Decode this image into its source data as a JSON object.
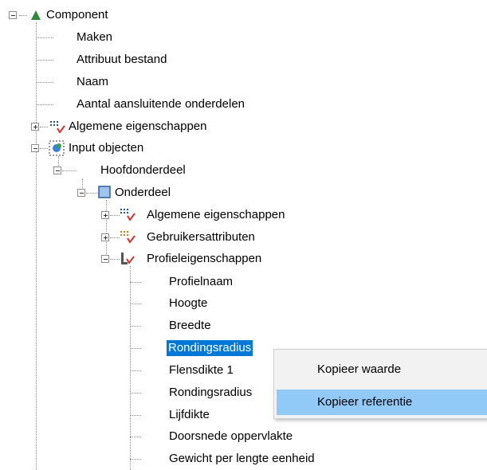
{
  "tree": {
    "component": "Component",
    "maken": "Maken",
    "attribuut_bestand": "Attribuut bestand",
    "naam": "Naam",
    "aantal": "Aantal aansluitende onderdelen",
    "algemene1": "Algemene eigenschappen",
    "input_objecten": "Input objecten",
    "hoofdonderdeel": "Hoofdonderdeel",
    "onderdeel": "Onderdeel",
    "algemene2": "Algemene eigenschappen",
    "gebruikersattributen": "Gebruikersattributen",
    "profieleigenschappen": "Profieleigenschappen",
    "profielnaam": "Profielnaam",
    "hoogte": "Hoogte",
    "breedte": "Breedte",
    "rondingsradius1": "Rondingsradius",
    "flensdikte1": "Flensdikte 1",
    "rondingsradius2": "Rondingsradius",
    "lijfdikte": "Lijfdikte",
    "doorsnede": "Doorsnede oppervlakte",
    "gewicht": "Gewicht per lengte eenheid"
  },
  "context_menu": {
    "kopieer_waarde": "Kopieer waarde",
    "kopieer_referentie": "Kopieer referentie"
  },
  "colors": {
    "selection": "#0078d7",
    "menu_hover": "#91c9f7",
    "menu_background": "#f2f2f2"
  }
}
